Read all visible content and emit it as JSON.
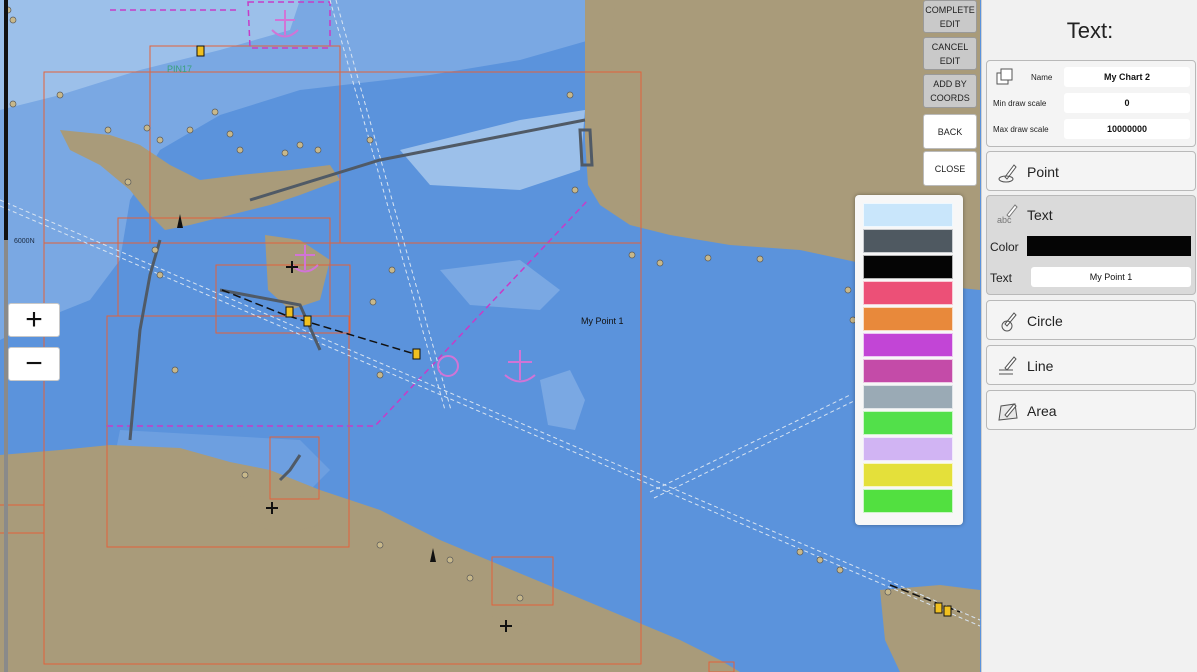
{
  "map": {
    "depth_label": "6000N",
    "annotation_text": "My Point 1",
    "pin_label": "PIN17"
  },
  "zoom": {
    "in_label": "+",
    "out_label": "−"
  },
  "toolbar": {
    "complete_edit": "COMPLETE EDIT",
    "cancel_edit": "CANCEL EDIT",
    "add_by_coords": "ADD BY COORDS",
    "back": "BACK",
    "close": "CLOSE"
  },
  "palette": {
    "colors": [
      "#c9e6fb",
      "#4f5961",
      "#050505",
      "#ec5077",
      "#e8893b",
      "#c245d6",
      "#c44ba8",
      "#9aaab5",
      "#52e04a",
      "#d1b4f3",
      "#e4e03a",
      "#52e040"
    ]
  },
  "panel": {
    "title": "Text:",
    "name_label": "Name",
    "name_value": "My Chart 2",
    "min_scale_label": "Min draw scale",
    "min_scale_value": "0",
    "max_scale_label": "Max draw scale",
    "max_scale_value": "10000000",
    "tools": {
      "point": "Point",
      "text": "Text",
      "circle": "Circle",
      "line": "Line",
      "area": "Area"
    },
    "color_label": "Color",
    "color_value": "#050505",
    "text_label": "Text",
    "text_value": "My Point 1"
  }
}
